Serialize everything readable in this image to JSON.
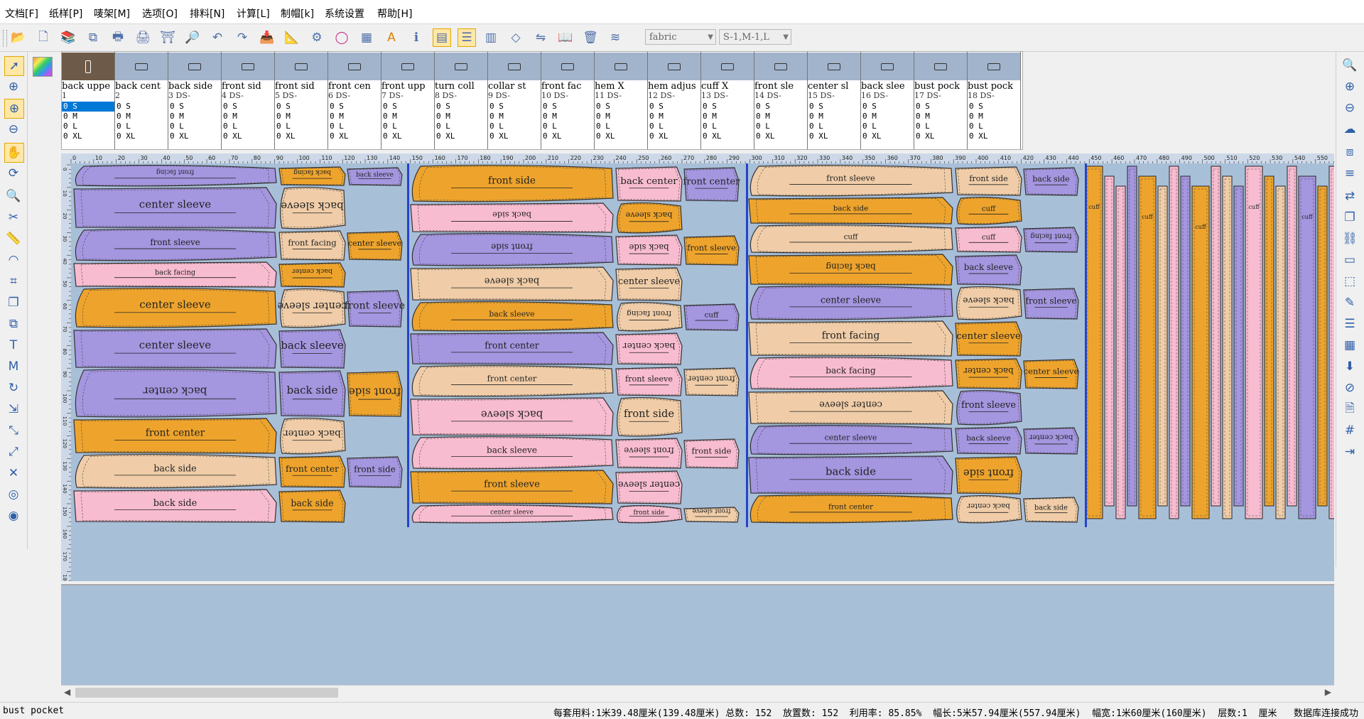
{
  "menu": [
    "文档[F]",
    "纸样[P]",
    "唛架[M]",
    "选项[O]",
    "排料[N]",
    "计算[L]",
    "制帽[k]",
    "系统设置",
    "帮助[H]"
  ],
  "toolbar": {
    "icons": [
      "open-folder-icon",
      "new-document-icon",
      "open-multiple-icon",
      "copy-icon",
      "print-preview-icon",
      "print-icon",
      "plotter-icon",
      "zoom-page-icon",
      "undo-icon",
      "redo-icon",
      "import-icon",
      "measure-icon",
      "settings-icon",
      "color-ring-icon",
      "grid-icon",
      "text-icon",
      "piece-info-icon",
      "layout-view-icon",
      "list-view-icon",
      "table-view-icon",
      "marker-icon",
      "flip-icon",
      "book-icon",
      "delete-icon",
      "layers-icon"
    ],
    "fabric_value": "fabric",
    "size_value": "S-1,M-1,L"
  },
  "pieces": [
    {
      "name": "back uppe",
      "num": "1"
    },
    {
      "name": "back cent",
      "num": "2"
    },
    {
      "name": "back side",
      "num": "3    DS-"
    },
    {
      "name": "front sid",
      "num": "4    DS-"
    },
    {
      "name": "front sid",
      "num": "5    DS-"
    },
    {
      "name": "front cen",
      "num": "6    DS-"
    },
    {
      "name": "front upp",
      "num": "7    DS-"
    },
    {
      "name": "turn coll",
      "num": "8    DS-"
    },
    {
      "name": "collar st",
      "num": "9    DS-"
    },
    {
      "name": "front fac",
      "num": "10   DS-"
    },
    {
      "name": "hem      X",
      "num": "11   DS-"
    },
    {
      "name": "hem adjus",
      "num": "12   DS-"
    },
    {
      "name": "cuff     X",
      "num": "13   DS-"
    },
    {
      "name": "front sle",
      "num": "14   DS-"
    },
    {
      "name": "center sl",
      "num": "15   DS-"
    },
    {
      "name": "back slee",
      "num": "16   DS-"
    },
    {
      "name": "bust pock",
      "num": "17   DS-"
    },
    {
      "name": "bust pock",
      "num": "18   DS-"
    }
  ],
  "size_rows": [
    "0 S",
    "0 M",
    "0 L",
    "0 XL"
  ],
  "ruler_top": [
    "0",
    "10",
    "20",
    "30",
    "40",
    "50",
    "60",
    "70",
    "80",
    "90",
    "100",
    "110",
    "120",
    "130",
    "140",
    "150",
    "160",
    "170",
    "180",
    "190",
    "200",
    "210",
    "220",
    "230",
    "240",
    "250",
    "260",
    "270",
    "280",
    "290",
    "300",
    "310",
    "320",
    "330",
    "340",
    "350",
    "360",
    "370",
    "380",
    "390",
    "400",
    "410",
    "420",
    "430",
    "440",
    "450",
    "460",
    "470",
    "480",
    "490",
    "500",
    "510",
    "520",
    "530",
    "540",
    "550"
  ],
  "ruler_left": [
    "0",
    "10",
    "20",
    "30",
    "40",
    "50",
    "60",
    "70",
    "80",
    "90",
    "100",
    "110",
    "120",
    "130",
    "140",
    "150",
    "160",
    "170",
    "180"
  ],
  "colors": {
    "purple": "#a596e0",
    "orange": "#eea42c",
    "peach": "#f0cda8",
    "pink": "#f8bcd0",
    "outline": "#333333",
    "divider": "#2244cc",
    "bg": "#a8bfd8"
  },
  "marker_pieces": [
    {
      "label": "front facing",
      "col": "purple",
      "flip": true
    },
    {
      "label": "back facing",
      "col": "orange",
      "flip": true
    },
    {
      "label": "back sleeve",
      "col": "purple"
    },
    {
      "label": "center sleeve",
      "col": "purple"
    },
    {
      "label": "back sleeve",
      "col": "peach",
      "flip": true
    },
    {
      "label": "front sleeve",
      "col": "purple"
    },
    {
      "label": "front facing",
      "col": "peach"
    },
    {
      "label": "center sleeve",
      "col": "orange"
    },
    {
      "label": "back facing",
      "col": "pink"
    },
    {
      "label": "back center",
      "col": "orange",
      "flip": true
    },
    {
      "label": "center sleeve",
      "col": "orange"
    },
    {
      "label": "center sleeve",
      "col": "peach",
      "flip": true
    },
    {
      "label": "front sleeve",
      "col": "purple"
    },
    {
      "label": "center sleeve",
      "col": "purple"
    },
    {
      "label": "back sleeve",
      "col": "purple"
    },
    {
      "label": "back center",
      "col": "purple",
      "flip": true
    },
    {
      "label": "back side",
      "col": "purple"
    },
    {
      "label": "front side",
      "col": "orange",
      "flip": true
    },
    {
      "label": "front center",
      "col": "orange"
    },
    {
      "label": "back center",
      "col": "peach",
      "flip": true
    },
    {
      "label": "back side",
      "col": "peach"
    },
    {
      "label": "front center",
      "col": "orange"
    },
    {
      "label": "front side",
      "col": "purple"
    },
    {
      "label": "back side",
      "col": "pink"
    },
    {
      "label": "back side",
      "col": "orange"
    },
    {
      "label": "front side",
      "col": "orange"
    },
    {
      "label": "back center",
      "col": "pink"
    },
    {
      "label": "front center",
      "col": "purple"
    },
    {
      "label": "back side",
      "col": "pink",
      "flip": true
    },
    {
      "label": "back sleeve",
      "col": "orange",
      "flip": true
    },
    {
      "label": "front side",
      "col": "purple",
      "flip": true
    },
    {
      "label": "back side",
      "col": "pink",
      "flip": true
    },
    {
      "label": "front sleeve",
      "col": "orange"
    },
    {
      "label": "back sleeve",
      "col": "peach",
      "flip": true
    },
    {
      "label": "center sleeve",
      "col": "peach"
    },
    {
      "label": "back sleeve",
      "col": "orange"
    },
    {
      "label": "front facing",
      "col": "peach",
      "flip": true
    },
    {
      "label": "cuff",
      "col": "purple"
    },
    {
      "label": "front center",
      "col": "purple"
    },
    {
      "label": "back center",
      "col": "pink",
      "flip": true
    },
    {
      "label": "front center",
      "col": "peach"
    },
    {
      "label": "front sleeve",
      "col": "pink"
    },
    {
      "label": "front center",
      "col": "peach",
      "flip": true
    },
    {
      "label": "back sleeve",
      "col": "pink",
      "flip": true
    },
    {
      "label": "front side",
      "col": "peach"
    },
    {
      "label": "back sleeve",
      "col": "pink"
    },
    {
      "label": "front sleeve",
      "col": "pink",
      "flip": true
    },
    {
      "label": "front side",
      "col": "pink"
    },
    {
      "label": "front sleeve",
      "col": "orange"
    },
    {
      "label": "center sleeve",
      "col": "pink",
      "flip": true
    },
    {
      "label": "center sleeve",
      "col": "pink"
    },
    {
      "label": "front side",
      "col": "pink"
    },
    {
      "label": "front sleeve",
      "col": "peach",
      "flip": true
    },
    {
      "label": "front sleeve",
      "col": "peach"
    },
    {
      "label": "front side",
      "col": "peach"
    },
    {
      "label": "back side",
      "col": "purple"
    },
    {
      "label": "back side",
      "col": "orange"
    },
    {
      "label": "cuff",
      "col": "orange"
    },
    {
      "label": "cuff",
      "col": "peach"
    },
    {
      "label": "cuff",
      "col": "pink"
    }
  ],
  "statusbar": {
    "left": "bust pocket",
    "right": "每套用料:1米39.48厘米(139.48厘米) 总数: 152  放置数: 152  利用率: 85.85%  幅长:5米57.94厘米(557.94厘米)  幅宽:1米60厘米(160厘米)  层数:1  厘米   数据库连接成功"
  }
}
